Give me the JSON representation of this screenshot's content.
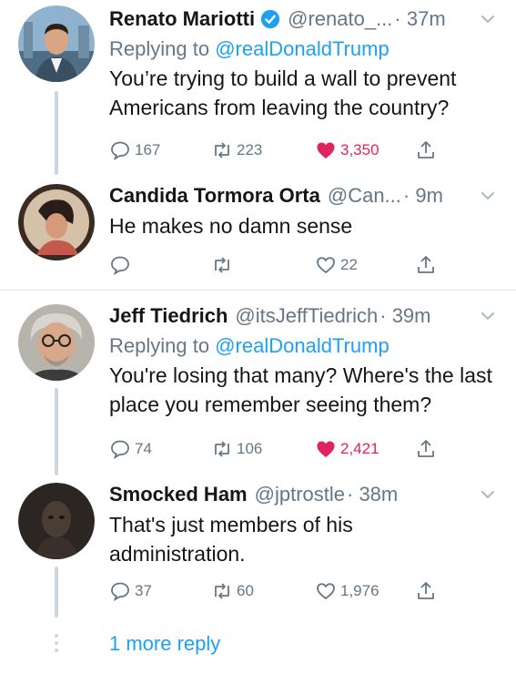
{
  "colors": {
    "accent": "#1da1f2",
    "like": "#e0245e",
    "muted": "#657786"
  },
  "tweets": [
    {
      "name": "Renato Mariotti",
      "verified": true,
      "handle": "@renato_...",
      "time": "· 37m",
      "reply_prefix": "Replying to",
      "reply_to": "@realDonaldTrump",
      "text": "You’re trying to build a wall to prevent Americans from leaving the country?",
      "replies": "167",
      "retweets": "223",
      "likes": "3,350",
      "liked": true
    },
    {
      "name": "Candida Tormora Orta",
      "handle": "@Can...",
      "time": "· 9m",
      "text": "He makes no damn sense",
      "replies": "",
      "retweets": "",
      "likes": "22",
      "liked": false
    },
    {
      "name": "Jeff Tiedrich",
      "handle": "@itsJeffTiedrich",
      "time": "· 39m",
      "reply_prefix": "Replying to",
      "reply_to": "@realDonaldTrump",
      "text": "You're losing that many? Where's the last place you remember seeing them?",
      "replies": "74",
      "retweets": "106",
      "likes": "2,421",
      "liked": true
    },
    {
      "name": "Smocked Ham",
      "handle": "@jptrostle",
      "time": "· 38m",
      "text": "That's just members of his administration.",
      "replies": "37",
      "retweets": "60",
      "likes": "1,976",
      "liked": false
    }
  ],
  "more_replies": "1 more reply"
}
